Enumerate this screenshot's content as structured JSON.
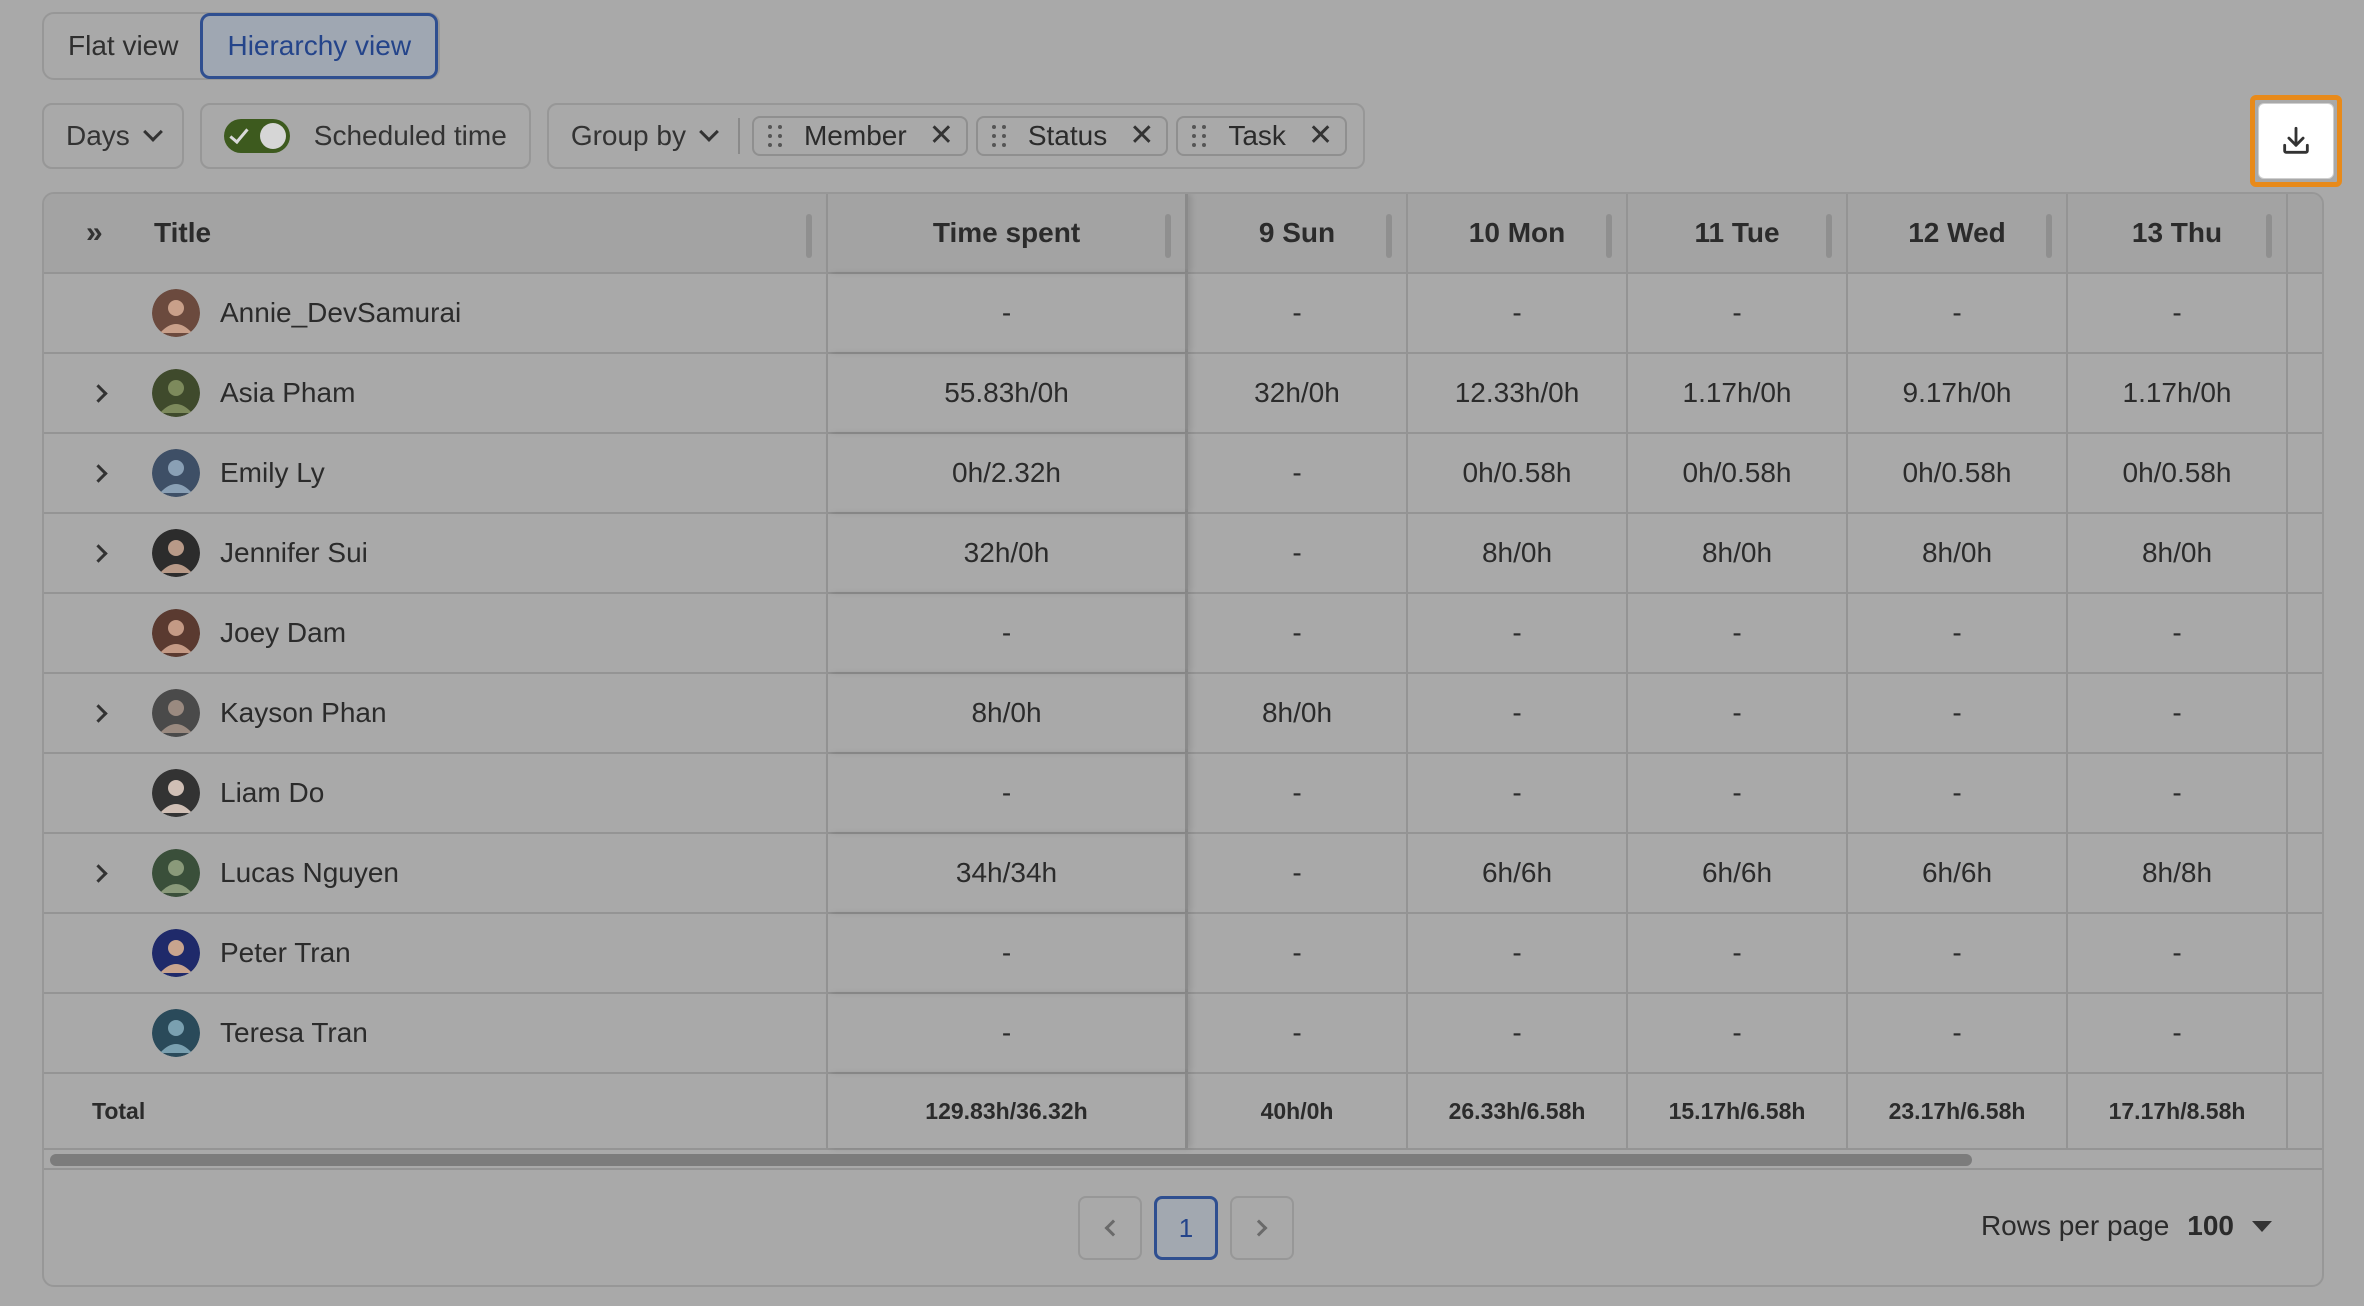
{
  "view_toggle": {
    "flat": "Flat view",
    "hierarchy": "Hierarchy view",
    "active": "hierarchy"
  },
  "toolbar": {
    "days_label": "Days",
    "scheduled_label": "Scheduled time",
    "scheduled_on": true,
    "group_by_label": "Group by",
    "chips": [
      "Member",
      "Status",
      "Task"
    ],
    "download_icon": "download-icon"
  },
  "table": {
    "headers": {
      "title": "Title",
      "time_spent": "Time spent",
      "days": [
        "9 Sun",
        "10 Mon",
        "11 Tue",
        "12 Wed",
        "13 Thu"
      ]
    },
    "rows": [
      {
        "name": "Annie_DevSamurai",
        "expandable": false,
        "time": "-",
        "days": [
          "-",
          "-",
          "-",
          "-",
          "-"
        ]
      },
      {
        "name": "Asia Pham",
        "expandable": true,
        "time": "55.83h/0h",
        "days": [
          "32h/0h",
          "12.33h/0h",
          "1.17h/0h",
          "9.17h/0h",
          "1.17h/0h"
        ]
      },
      {
        "name": "Emily Ly",
        "expandable": true,
        "time": "0h/2.32h",
        "days": [
          "-",
          "0h/0.58h",
          "0h/0.58h",
          "0h/0.58h",
          "0h/0.58h"
        ]
      },
      {
        "name": "Jennifer Sui",
        "expandable": true,
        "time": "32h/0h",
        "days": [
          "-",
          "8h/0h",
          "8h/0h",
          "8h/0h",
          "8h/0h"
        ]
      },
      {
        "name": "Joey Dam",
        "expandable": false,
        "time": "-",
        "days": [
          "-",
          "-",
          "-",
          "-",
          "-"
        ]
      },
      {
        "name": "Kayson Phan",
        "expandable": true,
        "time": "8h/0h",
        "days": [
          "8h/0h",
          "-",
          "-",
          "-",
          "-"
        ]
      },
      {
        "name": "Liam Do",
        "expandable": false,
        "time": "-",
        "days": [
          "-",
          "-",
          "-",
          "-",
          "-"
        ]
      },
      {
        "name": "Lucas Nguyen",
        "expandable": true,
        "time": "34h/34h",
        "days": [
          "-",
          "6h/6h",
          "6h/6h",
          "6h/6h",
          "8h/8h"
        ]
      },
      {
        "name": "Peter Tran",
        "expandable": false,
        "time": "-",
        "days": [
          "-",
          "-",
          "-",
          "-",
          "-"
        ]
      },
      {
        "name": "Teresa Tran",
        "expandable": false,
        "time": "-",
        "days": [
          "-",
          "-",
          "-",
          "-",
          "-"
        ]
      }
    ],
    "total": {
      "label": "Total",
      "time": "129.83h/36.32h",
      "days": [
        "40h/0h",
        "26.33h/6.58h",
        "15.17h/6.58h",
        "23.17h/6.58h",
        "17.17h/8.58h"
      ]
    }
  },
  "pagination": {
    "current_page": "1",
    "rows_per_page_label": "Rows per page",
    "rows_per_page_value": "100"
  },
  "colors": {
    "overlay_bg": "#a9a9a9",
    "accent": "#2f4f90",
    "highlight": "#e88a1a",
    "toggle_on": "#3d5a1e"
  }
}
